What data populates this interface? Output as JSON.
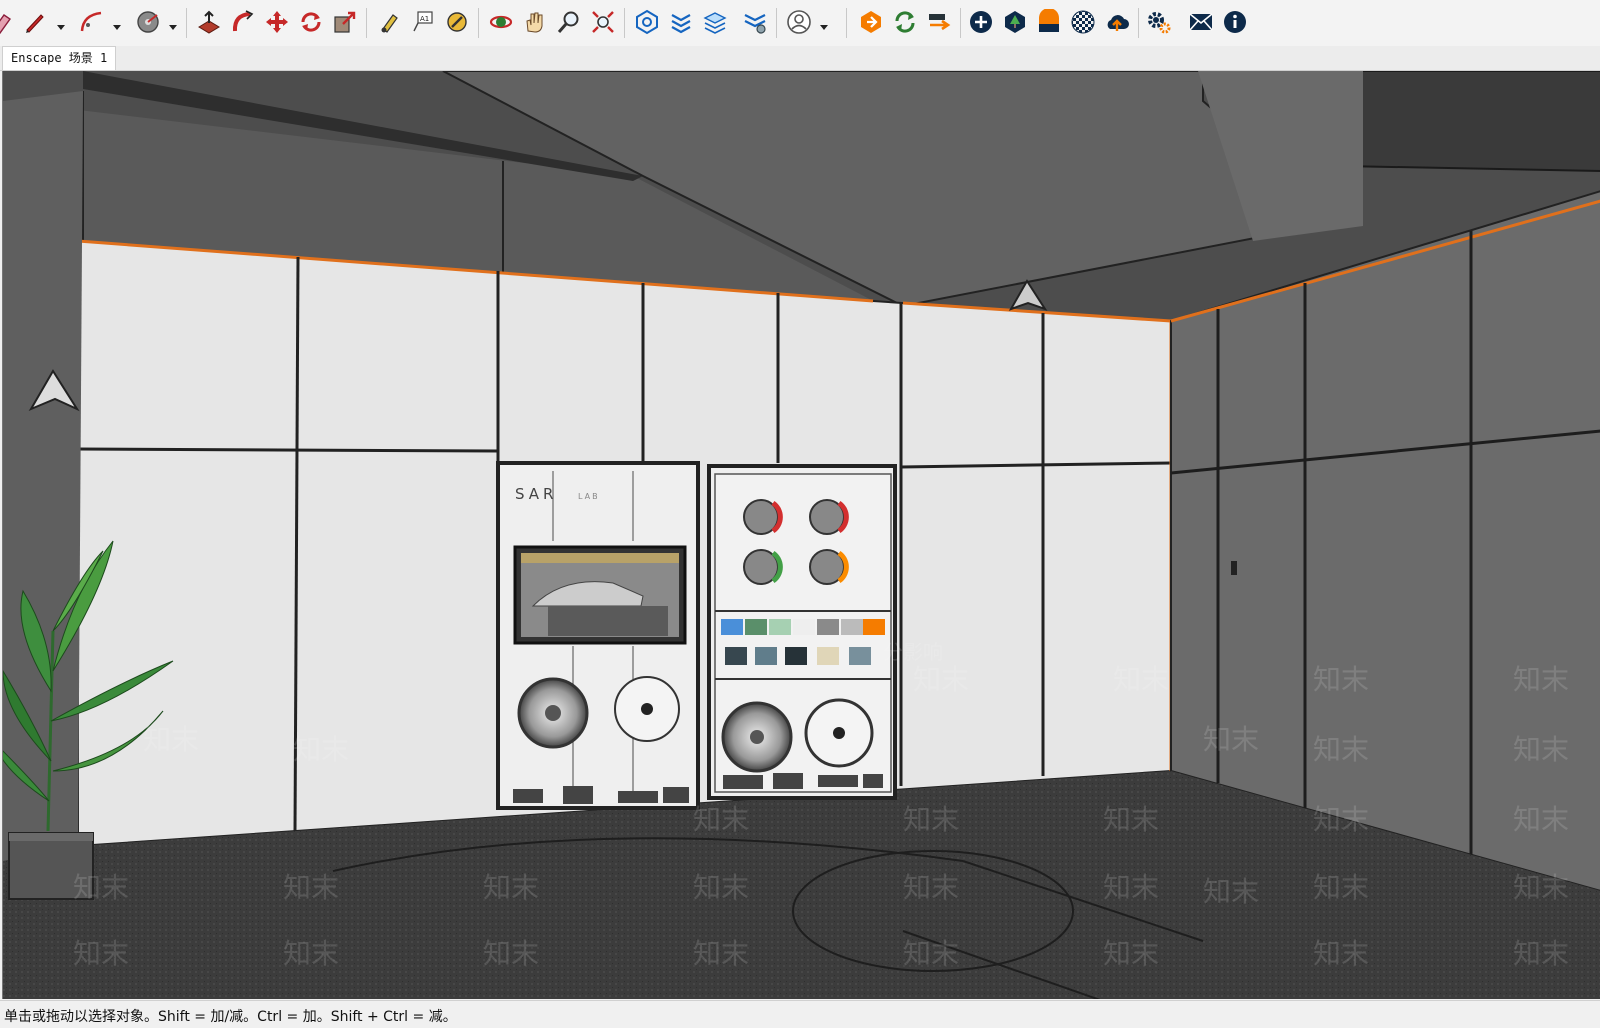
{
  "toolbar": {
    "groups": [
      [
        "pencil-tool",
        "arc-tool",
        "tape-measure-tool"
      ],
      [
        "push-pull-tool",
        "follow-me-tool",
        "move-tool",
        "rotate-tool",
        "scale-tool"
      ],
      [
        "paint-bucket-tool",
        "text-tool",
        "tag-tool"
      ],
      [
        "orbit-tool",
        "pan-tool",
        "zoom-tool",
        "zoom-extents-tool"
      ],
      [
        "warehouse-tool",
        "extension-tool",
        "layers-tool",
        "components-tool"
      ],
      [
        "account-tool"
      ],
      [
        "enscape-start",
        "enscape-sync",
        "enscape-capture"
      ],
      [
        "add-tool",
        "tree-tool",
        "material-tool",
        "checker-tool",
        "upload-tool"
      ],
      [
        "settings-tool",
        "feedback-tool",
        "info-tool"
      ]
    ]
  },
  "tabs": {
    "scene_tab": "Enscape 场景 1"
  },
  "viewport": {
    "logo_text": "SAR",
    "logo_sub": "LAB",
    "watermark": "知末",
    "watermark_partial": "分影响"
  },
  "status": {
    "text": "单击或拖动以选择对象。Shift = 加/减。Ctrl = 加。Shift + Ctrl = 减。"
  }
}
